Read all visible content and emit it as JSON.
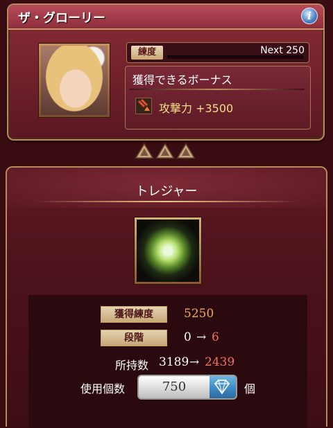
{
  "weapon_card": {
    "title": "ザ・グローリー",
    "info_icon": "i",
    "rank_label": "練度",
    "rank_next": "Next 250",
    "bonus_title": "獲得できるボーナス",
    "bonus_icon": "attack-up-icon",
    "bonus_text": "攻撃力 +3500"
  },
  "rank_triangles": 3,
  "treasure": {
    "title": "トレジャー",
    "item_icon": "emerald-gem-icon",
    "stats": {
      "proficiency_label": "獲得練度",
      "proficiency_value": "5250",
      "stage_label": "段階",
      "stage_from": "0",
      "stage_arrow": "→",
      "stage_to": "6",
      "owned_label": "所持数",
      "owned_from": "3189",
      "owned_arrow": "→",
      "owned_to": "2439"
    },
    "quantity": {
      "label": "使用個数",
      "value": "750",
      "unit": "個",
      "button_icon": "gem-select-icon"
    }
  },
  "colors": {
    "frame_gold": "#b98a5c",
    "panel_red": "#5e1823",
    "value_orange": "#f0a860",
    "value_red": "#f07060",
    "bonus_yellow": "#f3df8a"
  }
}
